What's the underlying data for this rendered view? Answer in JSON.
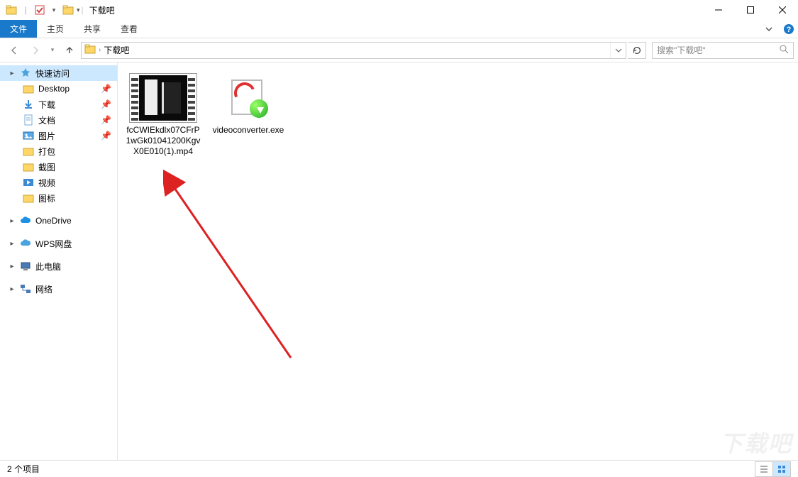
{
  "window": {
    "title": "下载吧",
    "minimize_tip": "Minimize",
    "maximize_tip": "Maximize",
    "close_tip": "Close"
  },
  "ribbon": {
    "file": "文件",
    "tabs": [
      "主页",
      "共享",
      "查看"
    ]
  },
  "address": {
    "crumbs": [
      "下载吧"
    ],
    "refresh_tip": "Refresh"
  },
  "search": {
    "placeholder": "搜索\"下载吧\""
  },
  "sidebar": {
    "quick_access": "快速访问",
    "quick_items": [
      {
        "label": "Desktop",
        "icon": "folder"
      },
      {
        "label": "下载",
        "icon": "download"
      },
      {
        "label": "文档",
        "icon": "document"
      },
      {
        "label": "图片",
        "icon": "pictures"
      },
      {
        "label": "打包",
        "icon": "folder"
      },
      {
        "label": "截图",
        "icon": "folder"
      },
      {
        "label": "视频",
        "icon": "video"
      },
      {
        "label": "图标",
        "icon": "folder"
      }
    ],
    "onedrive": "OneDrive",
    "wps": "WPS网盘",
    "thispc": "此电脑",
    "network": "网络"
  },
  "files": [
    {
      "name": "fcCWIEkdlx07CFrP1wGk01041200KgvX0E010(1).mp4",
      "type": "video"
    },
    {
      "name": "videoconverter.exe",
      "type": "exe"
    }
  ],
  "status": {
    "text": "2 个项目"
  },
  "watermark": "下载吧"
}
